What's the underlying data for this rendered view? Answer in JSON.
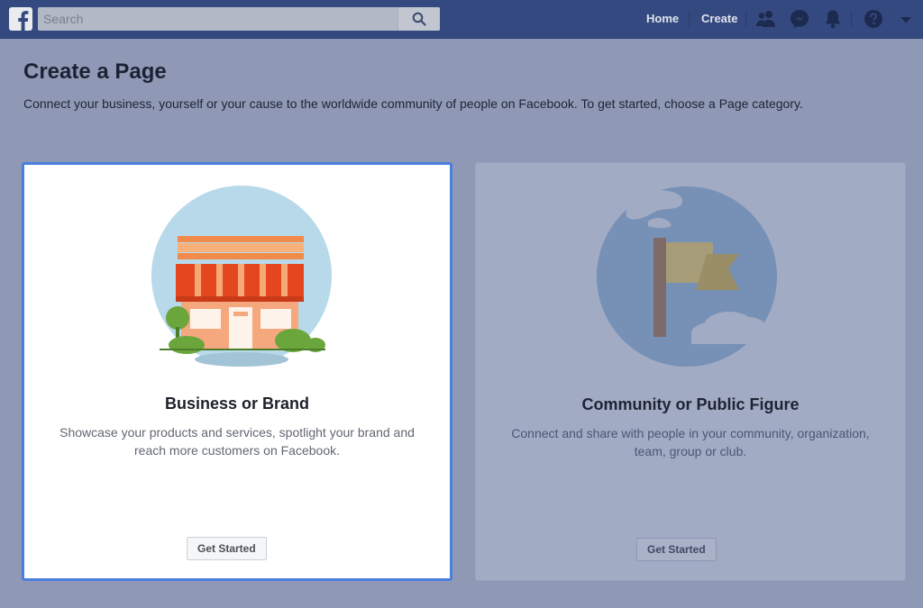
{
  "topbar": {
    "logo": "facebook-logo",
    "search": {
      "placeholder": "Search",
      "value": "",
      "icon": "search-icon"
    },
    "nav": {
      "home_label": "Home",
      "create_label": "Create"
    },
    "icons": [
      "friends-icon",
      "messenger-icon",
      "notifications-bell-icon",
      "help-icon",
      "account-dropdown-icon"
    ]
  },
  "page": {
    "title": "Create a Page",
    "description": "Connect your business, yourself or your cause to the worldwide community of people on Facebook. To get started, choose a Page category."
  },
  "cards": [
    {
      "illustration": "storefront-illustration",
      "title": "Business or Brand",
      "description_lines": [
        "Showcase your products and services, spotlight your brand and",
        "reach more customers on Facebook."
      ],
      "button_label": "Get Started",
      "selected": true
    },
    {
      "illustration": "flag-illustration",
      "title": "Community or Public Figure",
      "description_lines": [
        "Connect and share with people in your community, organization,",
        "team, group or club."
      ],
      "button_label": "Get Started",
      "selected": false
    }
  ],
  "colors": {
    "topbar": "#34497f",
    "overlay_background": "#8f99b6",
    "selection_border": "#4a7fe0"
  }
}
